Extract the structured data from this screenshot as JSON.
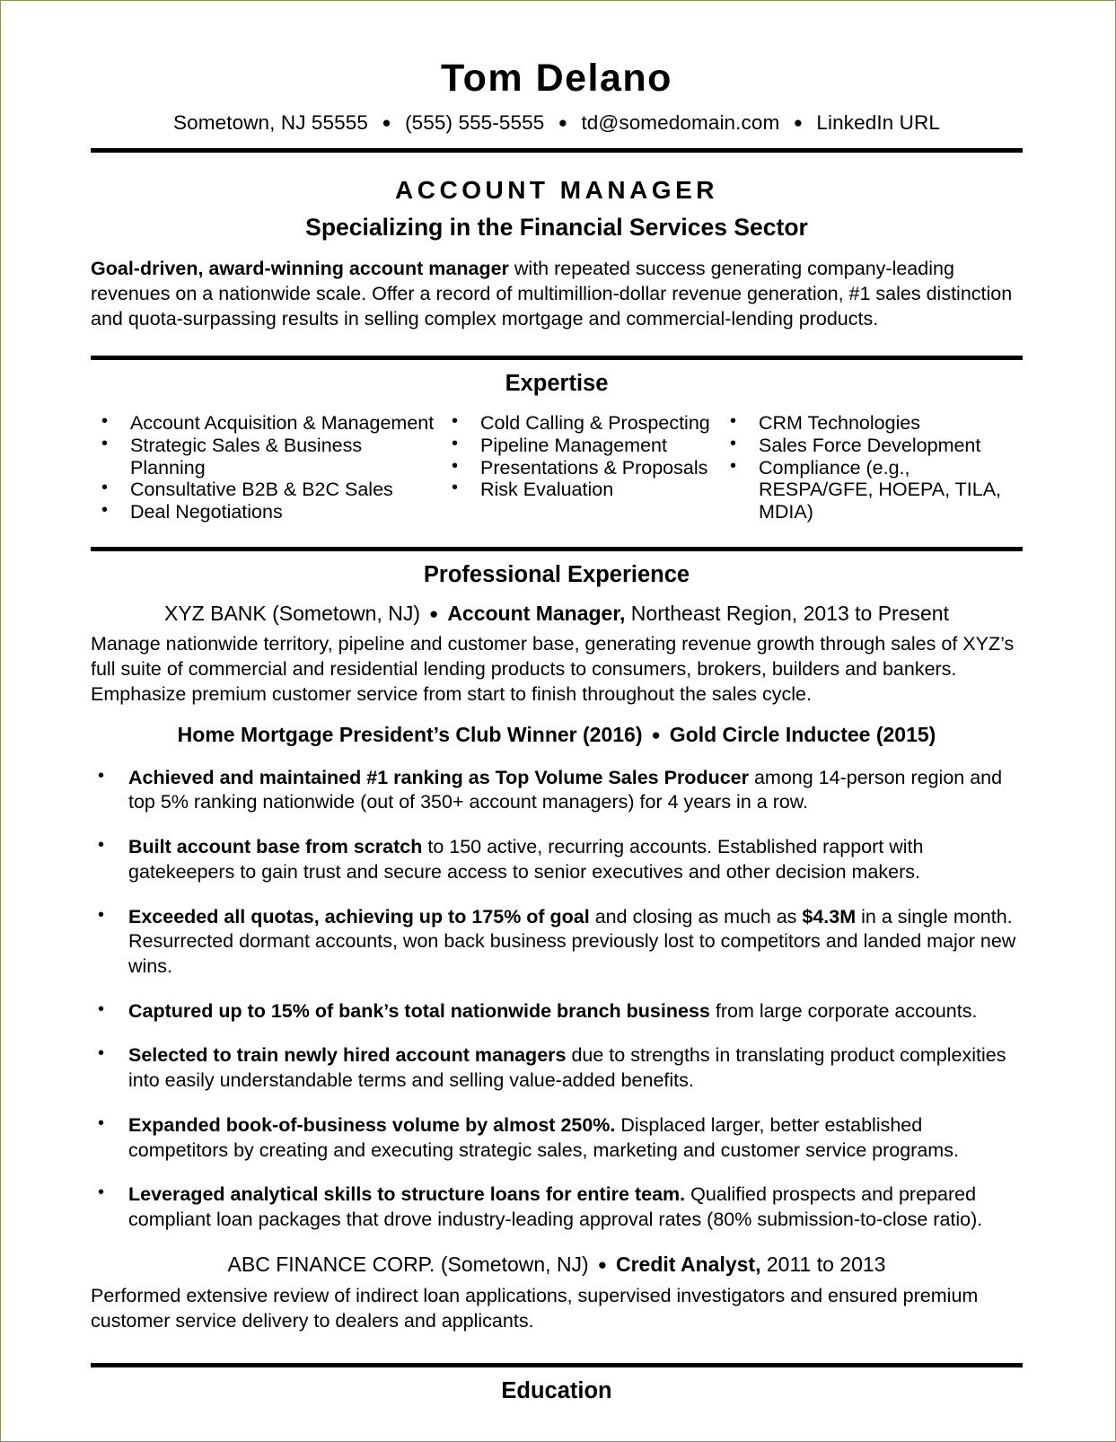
{
  "header": {
    "name": "Tom Delano",
    "contact": {
      "location": "Sometown, NJ 55555",
      "phone": "(555) 555-5555",
      "email": "td@somedomain.com",
      "linkedin": "LinkedIn URL",
      "separator": "●"
    }
  },
  "title_block": {
    "job_title": "ACCOUNT MANAGER",
    "subtitle": "Specializing in the Financial Services Sector",
    "summary_bold": "Goal-driven, award-winning account manager",
    "summary_rest": " with repeated success generating company-leading revenues on a nationwide scale. Offer a record of multimillion-dollar revenue generation, #1 sales distinction and quota-surpassing results in selling complex mortgage and commercial-lending products."
  },
  "expertise": {
    "heading": "Expertise",
    "column1": [
      "Account Acquisition & Management",
      "Strategic Sales & Business Planning",
      "Consultative B2B & B2C Sales",
      "Deal Negotiations"
    ],
    "column2": [
      "Cold Calling & Prospecting",
      "Pipeline Management",
      "Presentations & Proposals",
      "Risk Evaluation"
    ],
    "column3": [
      "CRM Technologies",
      "Sales Force Development",
      "Compliance (e.g., RESPA/GFE, HOEPA, TILA, MDIA)"
    ]
  },
  "experience": {
    "heading": "Professional Experience",
    "job1": {
      "company": "XYZ BANK (Sometown, NJ)",
      "separator": "●",
      "role": "Account Manager,",
      "role_detail": " Northeast Region, 2013 to Present",
      "description": "Manage nationwide territory, pipeline and customer base, generating revenue growth through sales of XYZ’s full suite of commercial and residential lending products to consumers, brokers, builders and bankers. Emphasize premium customer service from start to finish throughout the sales cycle.",
      "award1": "Home Mortgage President’s Club Winner (2016)",
      "award_separator": "●",
      "award2": "Gold Circle Inductee (2015)",
      "achievements": [
        {
          "bold": "Achieved and maintained #1 ranking as Top Volume Sales Producer",
          "rest": " among 14-person region and top 5% ranking nationwide (out of 350+ account managers) for 4 years in a row."
        },
        {
          "bold": "Built account base from scratch",
          "rest": " to 150 active, recurring accounts. Established rapport with gatekeepers to gain trust and secure access to senior executives and other decision makers."
        },
        {
          "bold": "Exceeded all quotas, achieving up to 175% of goal",
          "rest": " and closing as much as ",
          "bold2": "$4.3M",
          "rest2": " in a single month. Resurrected dormant accounts, won back business previously lost to competitors and landed major new wins."
        },
        {
          "bold": "Captured up to 15% of bank’s total nationwide branch business",
          "rest": " from large corporate accounts."
        },
        {
          "bold": "Selected to train newly hired account managers",
          "rest": " due to strengths in translating product complexities into easily understandable terms and selling value-added benefits."
        },
        {
          "bold": "Expanded book-of-business volume by almost 250%.",
          "rest": " Displaced larger, better established competitors by creating and executing strategic sales, marketing and customer service programs."
        },
        {
          "bold": "Leveraged analytical skills to structure loans for entire team.",
          "rest": " Qualified prospects and prepared compliant loan packages that drove industry-leading approval rates (80% submission-to-close ratio)."
        }
      ]
    },
    "job2": {
      "company": "ABC FINANCE CORP. (Sometown, NJ)",
      "separator": "●",
      "role": "Credit Analyst,",
      "role_detail": " 2011 to 2013",
      "description": "Performed extensive review of indirect loan applications, supervised investigators and ensured premium customer service delivery to dealers and applicants."
    }
  },
  "education": {
    "heading": "Education"
  }
}
